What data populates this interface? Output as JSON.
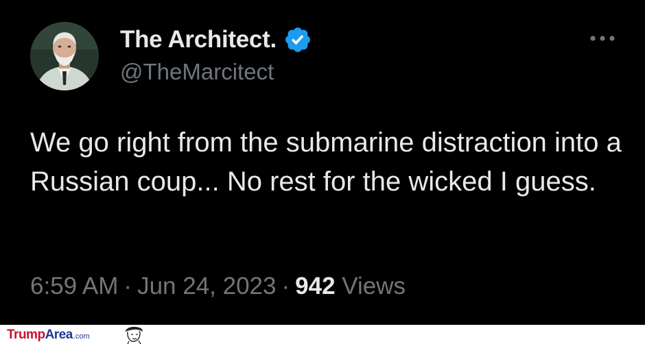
{
  "tweet": {
    "display_name": "The Architect.",
    "handle": "@TheMarcitect",
    "verified": true,
    "text": "We go right from the submarine distraction into a Russian coup... No rest for the wicked I guess.",
    "time": "6:59 AM",
    "separator": "·",
    "date": "Jun 24, 2023",
    "view_count": "942",
    "views_label": "Views"
  },
  "icons": {
    "avatar": "avatar-photo",
    "verified": "verified-badge-icon",
    "more": "more-options-icon"
  },
  "colors": {
    "background": "#000000",
    "primary_text": "#e7e9ea",
    "secondary_text": "#71767b",
    "verified_blue": "#1d9bf0"
  },
  "watermark": {
    "brand_part1": "Trump",
    "brand_part2": "Area",
    "brand_tld": ".com"
  }
}
